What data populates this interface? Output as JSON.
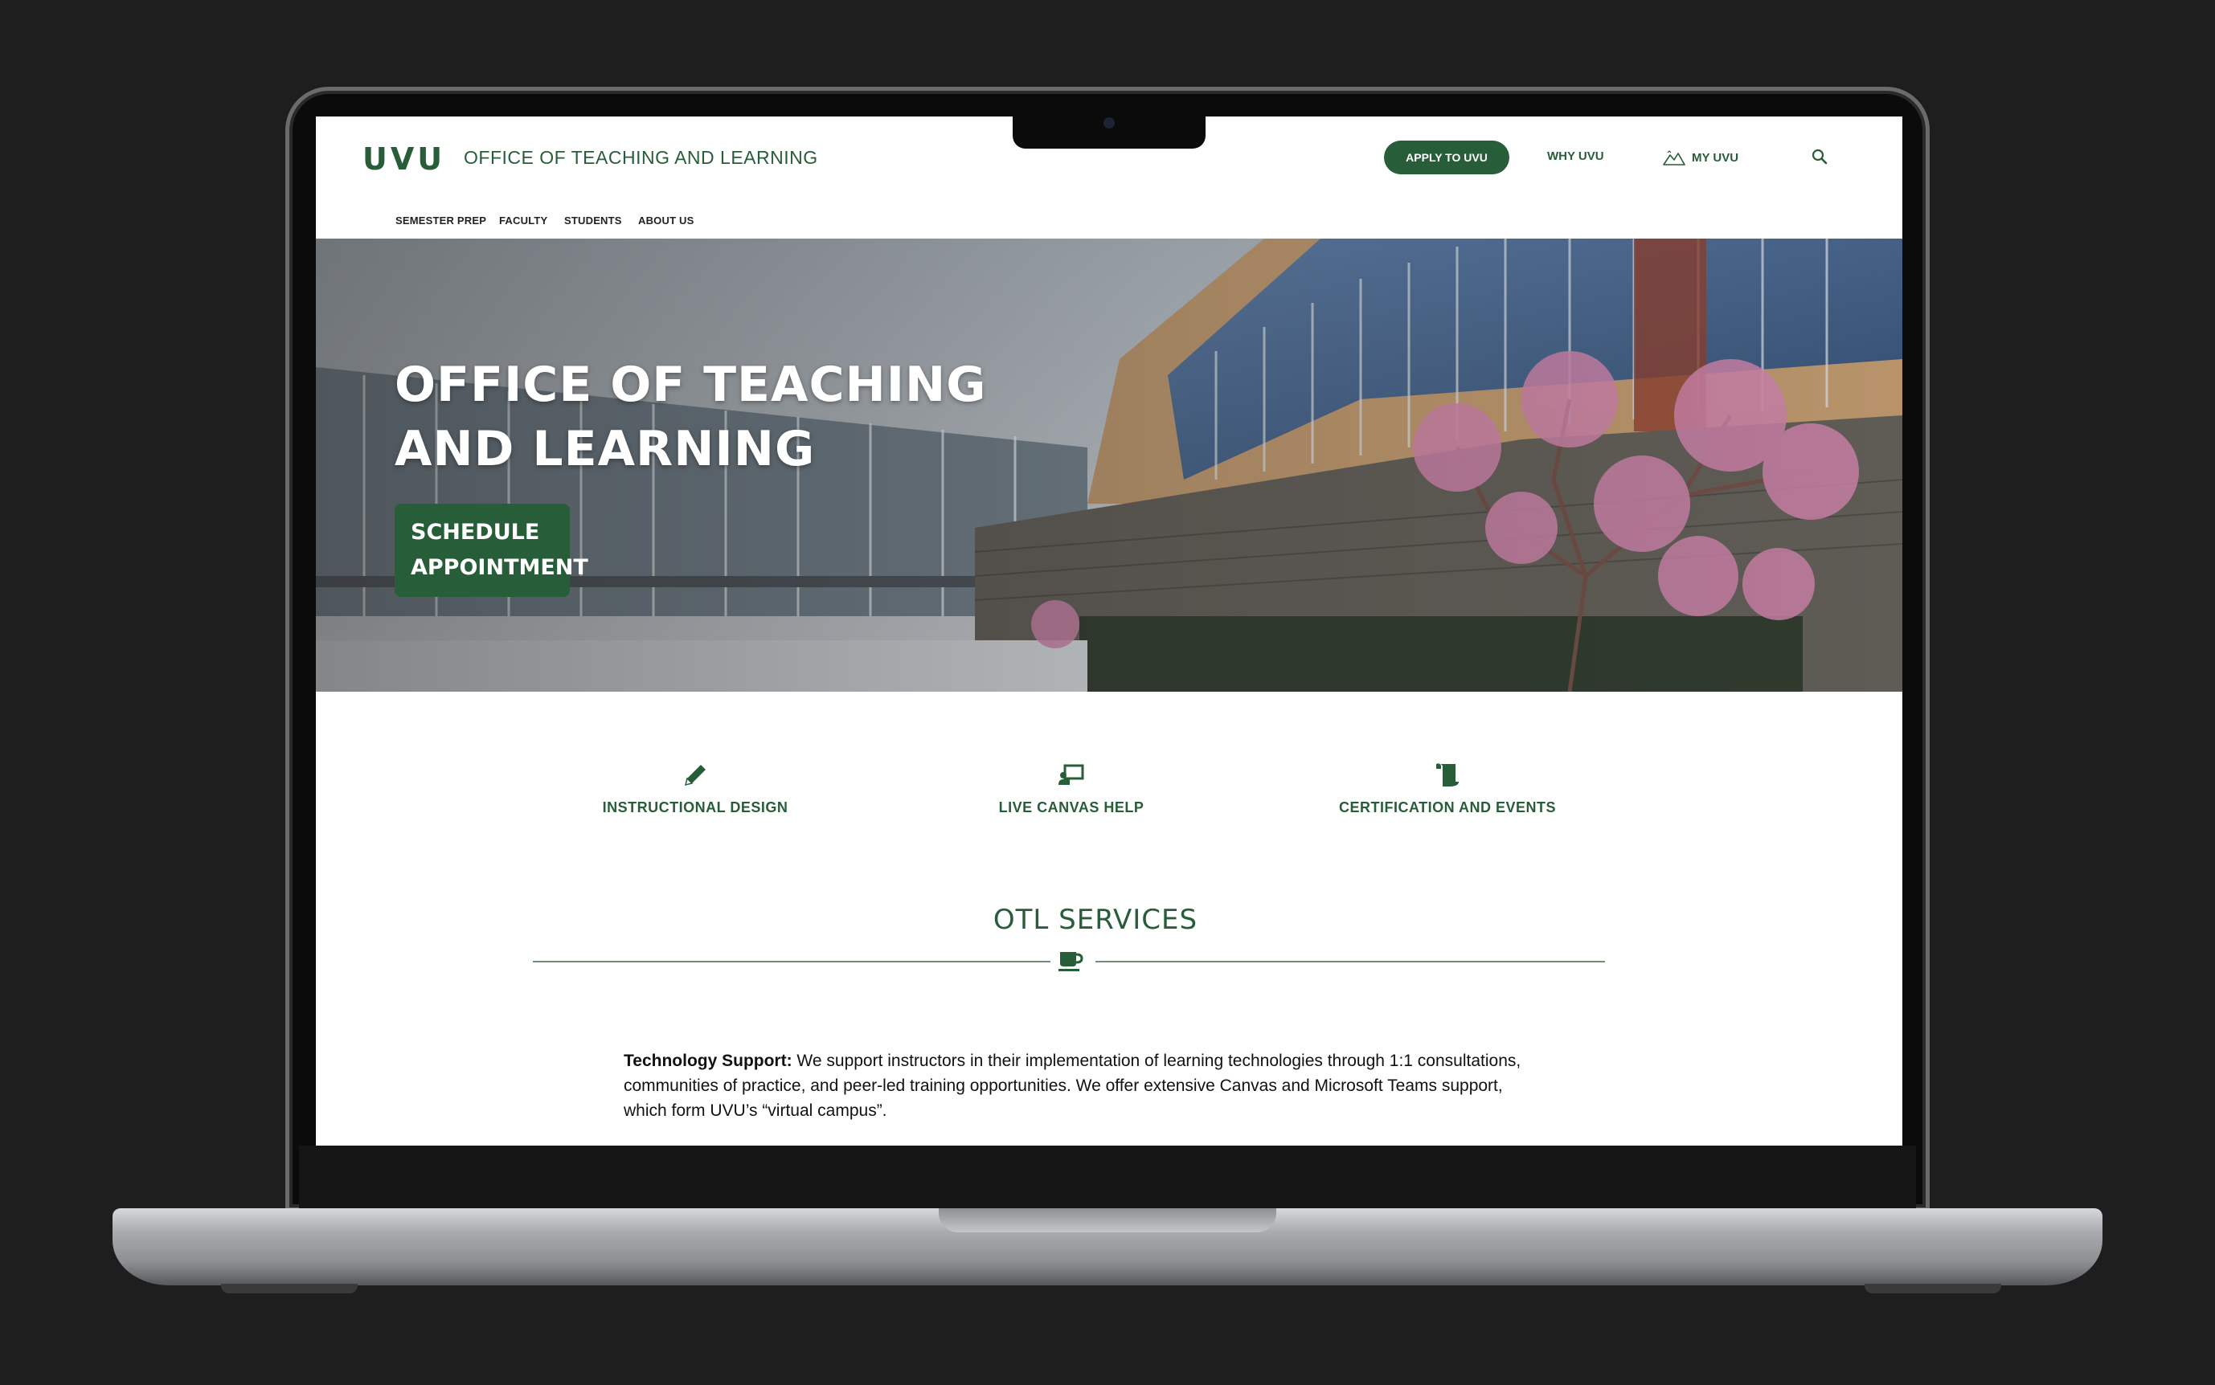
{
  "header": {
    "logo": "UVU",
    "site_title": "OFFICE OF TEACHING AND LEARNING",
    "apply_label": "APPLY TO UVU",
    "why_label": "WHY UVU",
    "myuvu_label": "MY UVU",
    "icons": [
      "mountain-icon",
      "search-icon"
    ]
  },
  "subnav": {
    "items": [
      {
        "label": "SEMESTER PREP"
      },
      {
        "label": "FACULTY"
      },
      {
        "label": "STUDENTS"
      },
      {
        "label": "ABOUT US"
      }
    ]
  },
  "hero": {
    "title": "OFFICE OF TEACHING AND LEARNING",
    "button_label": "SCHEDULE APPOINTMENT"
  },
  "quick_links": [
    {
      "label": "INSTRUCTIONAL DESIGN",
      "icon": "pencil-icon"
    },
    {
      "label": "LIVE CANVAS HELP",
      "icon": "teacher-icon"
    },
    {
      "label": "CERTIFICATION AND EVENTS",
      "icon": "scroll-icon"
    }
  ],
  "services": {
    "title": "OTL SERVICES",
    "divider_icon": "coffee-cup-icon",
    "paragraph_lead": "Technology Support:",
    "paragraph_body": " We support instructors in their implementation of learning technologies through 1:1 consultations, communities of practice, and peer-led training opportunities. We offer extensive Canvas and Microsoft Teams support, which form UVU’s “virtual campus”."
  },
  "colors": {
    "brand_green": "#275d38",
    "page_background": "#1e1e1e"
  }
}
